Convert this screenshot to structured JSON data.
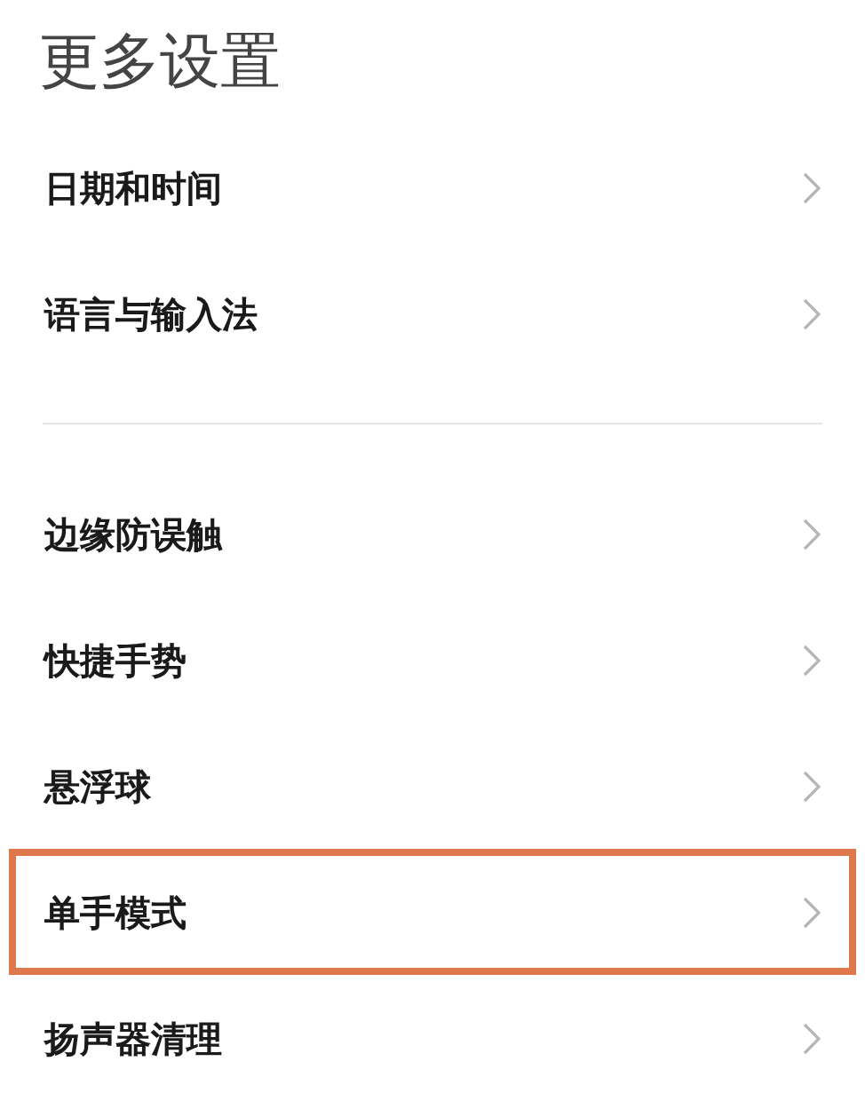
{
  "title": "更多设置",
  "groups": [
    [
      {
        "label": "日期和时间",
        "highlighted": false
      },
      {
        "label": "语言与输入法",
        "highlighted": false
      }
    ],
    [
      {
        "label": "边缘防误触",
        "highlighted": false
      },
      {
        "label": "快捷手势",
        "highlighted": false
      },
      {
        "label": "悬浮球",
        "highlighted": false
      },
      {
        "label": "单手模式",
        "highlighted": true
      },
      {
        "label": "扬声器清理",
        "highlighted": false
      }
    ]
  ]
}
